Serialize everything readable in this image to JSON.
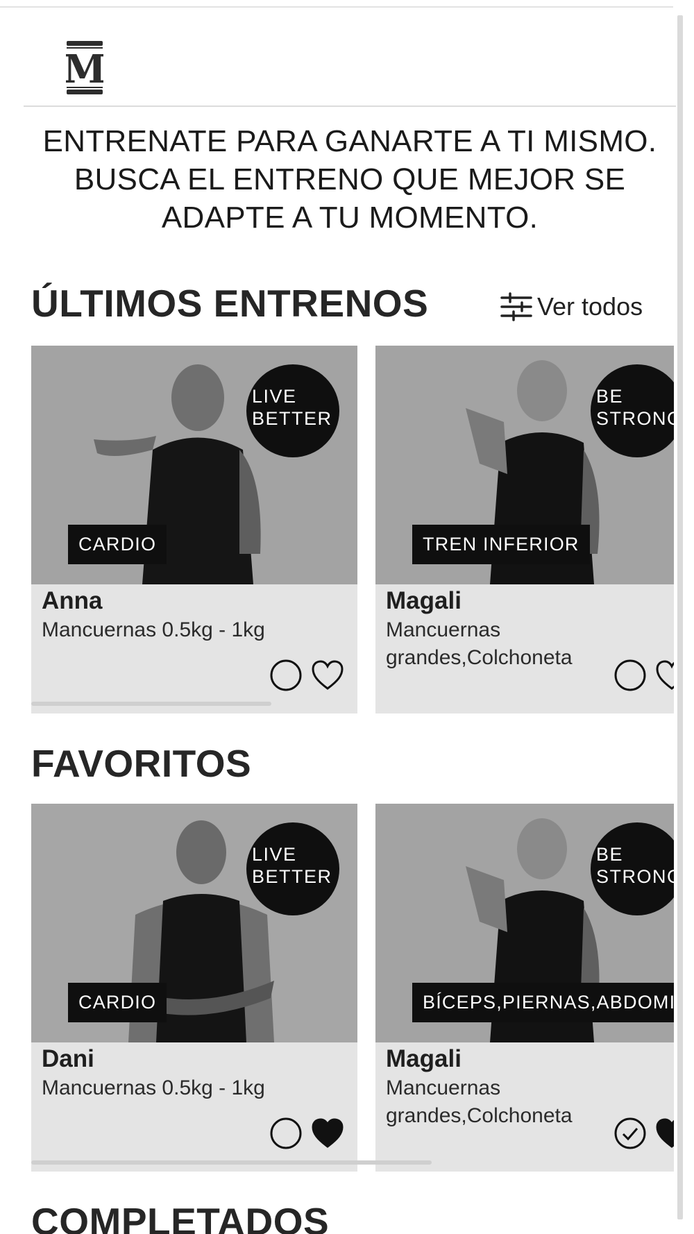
{
  "brand": {
    "logo_letter": "M"
  },
  "tagline": [
    "ENTRENATE PARA GANARTE A TI MISMO.",
    "BUSCA EL ENTRENO QUE MEJOR SE",
    "ADAPTE A TU MOMENTO."
  ],
  "latest": {
    "title": "ÚLTIMOS ENTRENOS",
    "view_all_label": "Ver todos",
    "cards": [
      {
        "trainer": "Anna",
        "badge": "LIVE\nBETTER",
        "category": "CARDIO",
        "equipment": "Mancuernas 0.5kg - 1kg",
        "completed": false,
        "favorite": false
      },
      {
        "trainer": "Magali",
        "badge": "BE\nSTRONG",
        "category": "TREN INFERIOR",
        "equipment": "Mancuernas grandes,Colchoneta",
        "completed": false,
        "favorite": false
      }
    ]
  },
  "favorites": {
    "title": "FAVORITOS",
    "cards": [
      {
        "trainer": "Dani",
        "badge": "LIVE\nBETTER",
        "category": "CARDIO",
        "equipment": "Mancuernas 0.5kg - 1kg",
        "completed": false,
        "favorite": true
      },
      {
        "trainer": "Magali",
        "badge": "BE\nSTRONG",
        "category": "BÍCEPS,PIERNAS,ABDOMIN...",
        "equipment": "Mancuernas grandes,Colchoneta",
        "completed": true,
        "favorite": true
      }
    ]
  },
  "completed_section": {
    "title": "COMPLETADOS"
  },
  "icons": {
    "filter": "sliders-icon",
    "completed": "circle-check-icon",
    "favorite": "heart-icon",
    "photo": "trainer-photo"
  },
  "colors": {
    "card_bg": "#e4e4e4",
    "tag_bg": "#0f0f0f",
    "text": "#1e1e1e"
  }
}
